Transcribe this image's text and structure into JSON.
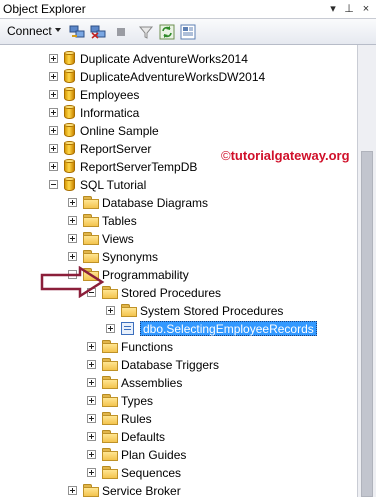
{
  "window": {
    "title": "Object Explorer",
    "controls": {
      "pin": "▾",
      "autohide": "⊥",
      "close": "×"
    }
  },
  "toolbar": {
    "connect_label": "Connect",
    "tools": [
      "connect-object-explorer-icon",
      "disconnect-icon",
      "stop-icon",
      "filter-icon",
      "refresh-icon",
      "summary-icon"
    ]
  },
  "watermark": {
    "copyright": "©",
    "text": "tutorialgateway.org"
  },
  "tree": {
    "items": [
      {
        "label": "Duplicate AdventureWorks2014",
        "icon": "database-icon",
        "level": 0,
        "expander": "plus"
      },
      {
        "label": "DuplicateAdventureWorksDW2014",
        "icon": "database-icon",
        "level": 0,
        "expander": "plus"
      },
      {
        "label": "Employees",
        "icon": "database-icon",
        "level": 0,
        "expander": "plus"
      },
      {
        "label": "Informatica",
        "icon": "database-icon",
        "level": 0,
        "expander": "plus"
      },
      {
        "label": "Online Sample",
        "icon": "database-icon",
        "level": 0,
        "expander": "plus"
      },
      {
        "label": "ReportServer",
        "icon": "database-icon",
        "level": 0,
        "expander": "plus"
      },
      {
        "label": "ReportServerTempDB",
        "icon": "database-icon",
        "level": 0,
        "expander": "plus"
      },
      {
        "label": "SQL Tutorial",
        "icon": "database-icon",
        "level": 0,
        "expander": "minus"
      },
      {
        "label": "Database Diagrams",
        "icon": "folder-icon",
        "level": 1,
        "expander": "plus"
      },
      {
        "label": "Tables",
        "icon": "folder-icon",
        "level": 1,
        "expander": "plus"
      },
      {
        "label": "Views",
        "icon": "folder-icon",
        "level": 1,
        "expander": "plus"
      },
      {
        "label": "Synonyms",
        "icon": "folder-icon",
        "level": 1,
        "expander": "plus"
      },
      {
        "label": "Programmability",
        "icon": "folder-icon",
        "level": 1,
        "expander": "minus"
      },
      {
        "label": "Stored Procedures",
        "icon": "folder-icon",
        "level": 2,
        "expander": "minus"
      },
      {
        "label": "System Stored Procedures",
        "icon": "folder-icon",
        "level": 3,
        "expander": "plus"
      },
      {
        "label": "dbo.SelectingEmployeeRecords",
        "icon": "stored-procedure-icon",
        "level": 3,
        "expander": "plus",
        "selected": true
      },
      {
        "label": "Functions",
        "icon": "folder-icon",
        "level": 2,
        "expander": "plus"
      },
      {
        "label": "Database Triggers",
        "icon": "folder-icon",
        "level": 2,
        "expander": "plus"
      },
      {
        "label": "Assemblies",
        "icon": "folder-icon",
        "level": 2,
        "expander": "plus"
      },
      {
        "label": "Types",
        "icon": "folder-icon",
        "level": 2,
        "expander": "plus"
      },
      {
        "label": "Rules",
        "icon": "folder-icon",
        "level": 2,
        "expander": "plus"
      },
      {
        "label": "Defaults",
        "icon": "folder-icon",
        "level": 2,
        "expander": "plus"
      },
      {
        "label": "Plan Guides",
        "icon": "folder-icon",
        "level": 2,
        "expander": "plus"
      },
      {
        "label": "Sequences",
        "icon": "folder-icon",
        "level": 2,
        "expander": "plus"
      },
      {
        "label": "Service Broker",
        "icon": "folder-icon",
        "level": 1,
        "expander": "plus"
      }
    ]
  },
  "colors": {
    "selection": "#3399ff",
    "watermark": "#d0102a",
    "arrow": "#8b1f3a"
  }
}
